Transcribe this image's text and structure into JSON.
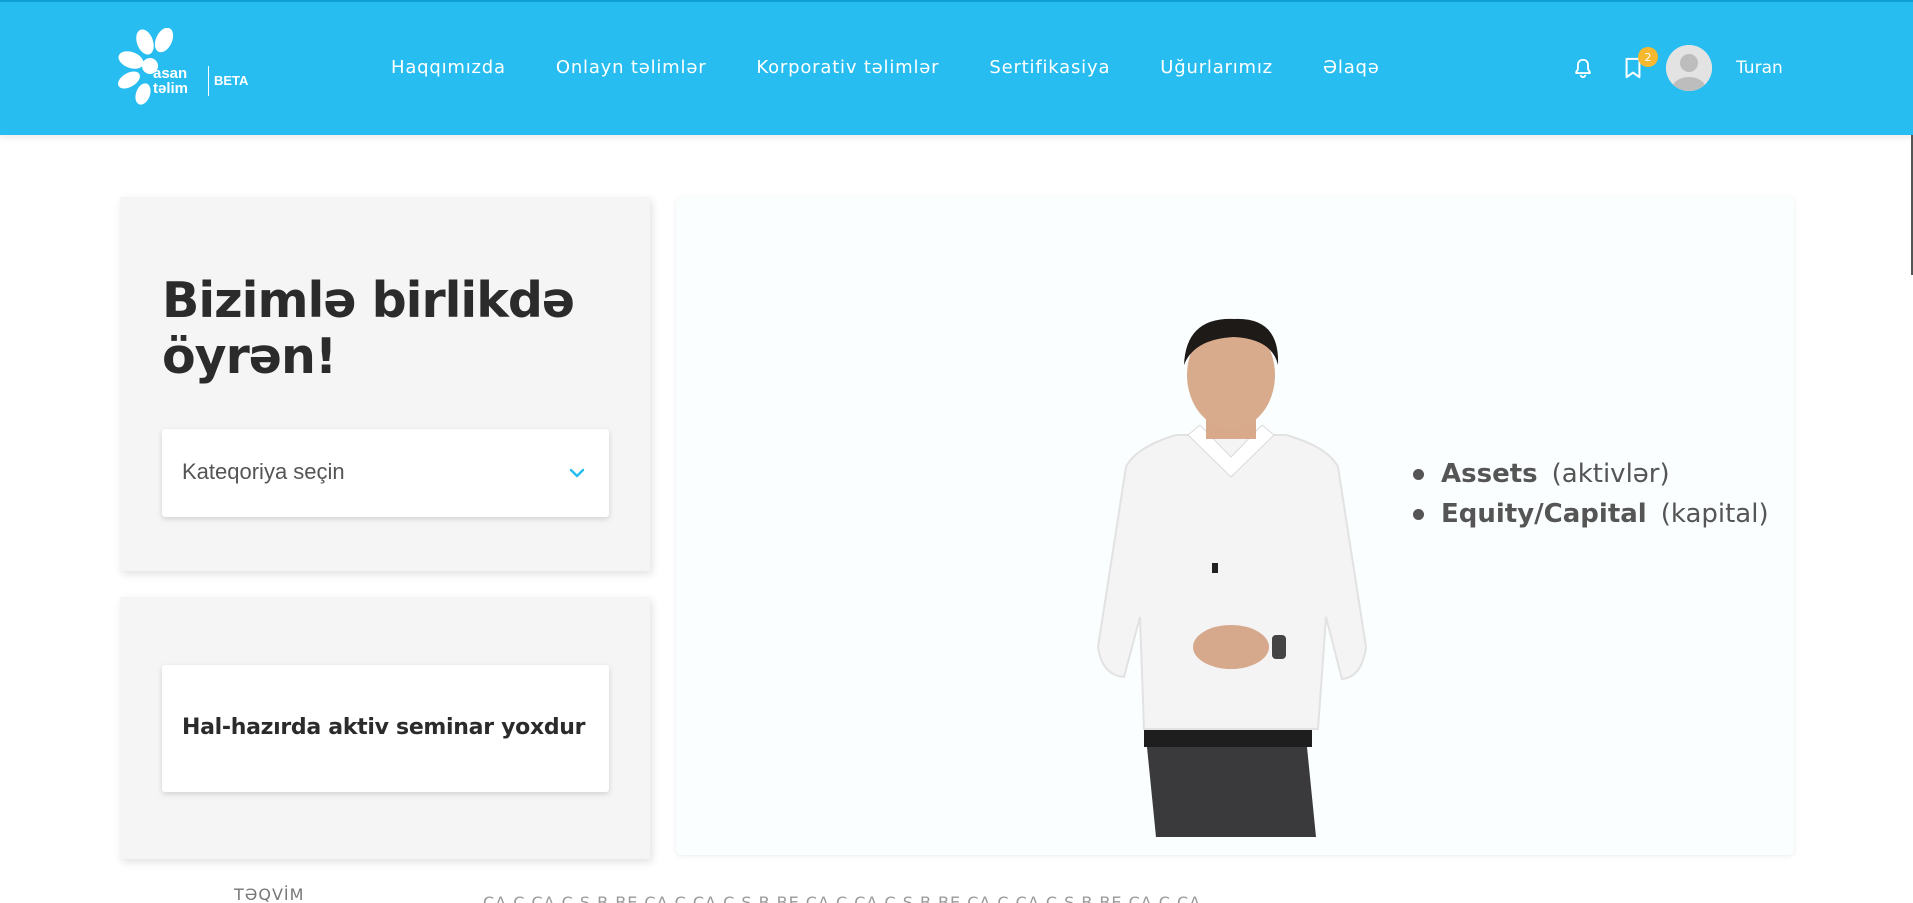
{
  "header": {
    "logo_line1": "asan",
    "logo_line2": "təlim",
    "logo_badge": "BETA",
    "nav": [
      "Haqqımızda",
      "Onlayn təlimlər",
      "Korporativ təlimlər",
      "Sertifikasiya",
      "Uğurlarımız",
      "Əlaqə"
    ],
    "bookmark_count": "2",
    "username": "Turan",
    "icons": {
      "notifications": "bell-icon",
      "bookmarks": "bookmark-icon",
      "user": "avatar-icon"
    },
    "colors": {
      "background": "#27bdf0",
      "badge": "#f5b82e"
    }
  },
  "hero": {
    "title": "Bizimlə birlikdə öyrən!",
    "category_select": {
      "value": "Kateqoriya seçin"
    }
  },
  "seminar": {
    "empty_text": "Hal-hazırda aktiv seminar yoxdur"
  },
  "video": {
    "bullets": [
      {
        "term": "Assets",
        "translation": "(aktivlər)"
      },
      {
        "term": "Equity/Capital",
        "translation": "(kapital)"
      }
    ]
  },
  "bottom": {
    "label": "TƏQVİM",
    "days": "ÇA    C    CA    Ç    Ş    B    BE    ÇA    C    CA    Ç    Ş    B    BE    ÇA    C    CA    Ç    Ş    B    BE    ÇA    C    CA    Ç    Ş    B    BE    ÇA    C    ÇA"
  }
}
